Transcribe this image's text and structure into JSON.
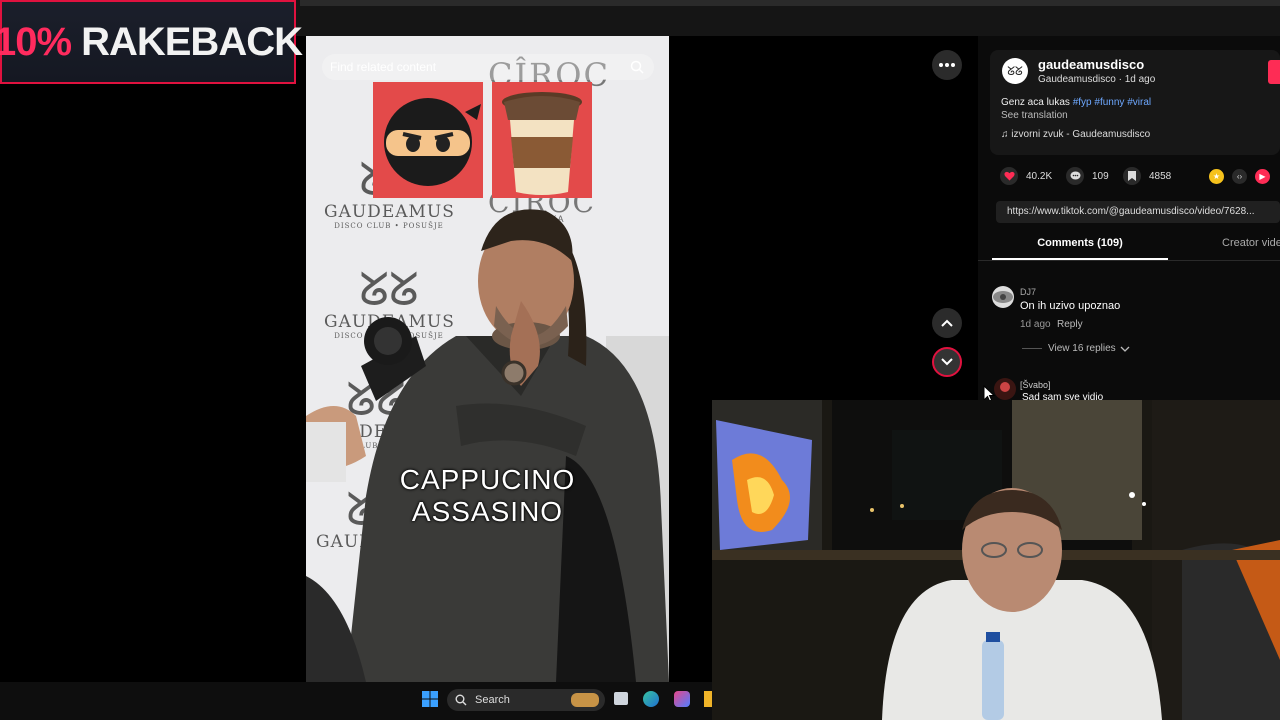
{
  "promo": {
    "percent": "10%",
    "word": "RAKEBACK"
  },
  "video": {
    "search_placeholder": "Find related content",
    "backdrop_brand": "GAUDEAMUS",
    "backdrop_sub": "DISCO CLUB • POSUŠJE",
    "vodka_brand": "CÎROC",
    "vodka_sub": "VODKA",
    "vodka_sub_full": "ULTRA PREMIUM VODKA",
    "caption_line1": "CAPPUCINO",
    "caption_line2": "ASSASINO"
  },
  "post": {
    "username": "gaudeamusdisco",
    "nickname_line": "Gaudeamusdisco · 1d ago",
    "desc_text": "Genz aca lukas ",
    "hashtags": "#fyp #funny #viral",
    "see_translation": "See translation",
    "music": "izvorni zvuk - Gaudeamusdisco",
    "likes": "40.2K",
    "comments_count": "109",
    "saves": "4858",
    "link": "https://www.tiktok.com/@gaudeamusdisco/video/7628...",
    "tab_comments": "Comments (109)",
    "tab_creator": "Creator videos"
  },
  "comments": [
    {
      "user": "DJ7",
      "text": "On ih uzivo upoznao",
      "time": "1d ago",
      "reply": "Reply",
      "view_replies": "View 16 replies"
    },
    {
      "user": "[Švabo]",
      "text": "Sad sam sve vidio"
    }
  ],
  "taskbar": {
    "search_label": "Search"
  },
  "colors": {
    "accent": "#e0123f",
    "tiktok_pink": "#fe2c55",
    "hashtag": "#6ea8ff"
  }
}
